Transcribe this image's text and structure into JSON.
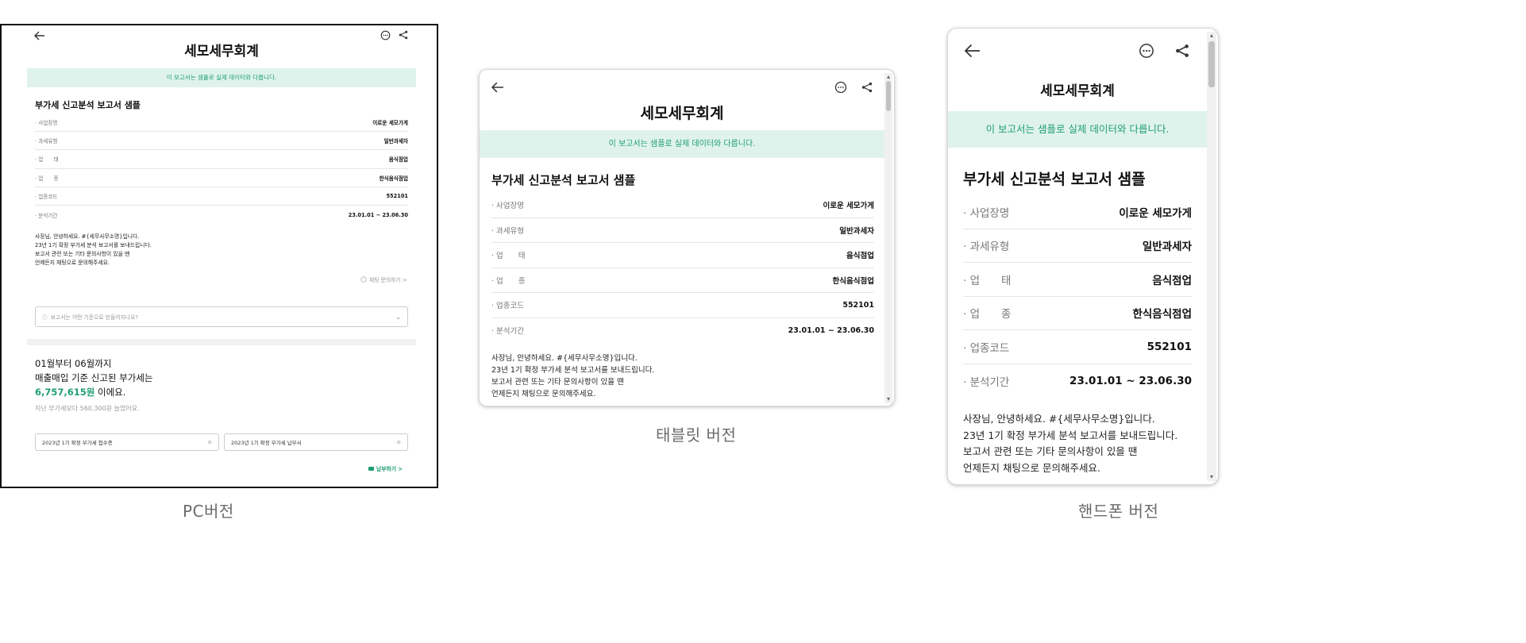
{
  "common": {
    "brand": "세모세무회계",
    "banner": "이 보고서는 샘플로 실제 데이터와 다릅니다.",
    "report_title": "부가세 신고분석 보고서 샘플",
    "rows": [
      {
        "label": "· 사업장명",
        "value": "이로운 세모가게"
      },
      {
        "label": "· 과세유형",
        "value": "일반과세자"
      },
      {
        "label": "· 업　　태",
        "value": "음식점업"
      },
      {
        "label": "· 업　　종",
        "value": "한식음식점업"
      },
      {
        "label": "· 업종코드",
        "value": "552101"
      },
      {
        "label": "· 분석기간",
        "value": "23.01.01 ~ 23.06.30"
      }
    ],
    "message_lines": [
      "사장님, 안녕하세요. #{세무사무소명}입니다.",
      "23년 1기 확정 부가세 분석 보고서를 보내드립니다.",
      "보고서 관련 또는 기타 문의사항이 있을 땐",
      "언제든지 채팅으로 문의해주세요."
    ],
    "icons": {
      "back": "back-arrow-icon",
      "chat": "chat-icon",
      "share": "share-icon"
    }
  },
  "pc": {
    "caption": "PC버전",
    "chat_link": "채팅 문의하기 >",
    "faq_placeholder": "보고서는 어떤 기준으로 만들어지나요?",
    "summary_line1": "01월부터 06월까지",
    "summary_line2": "매출매입 기준 신고된 부가세는",
    "summary_amount": "6,757,615원",
    "summary_suffix": " 이에요.",
    "summary_sub": "지난 부가세보다 560,300원 늘었어요.",
    "file1": "2023년 1기 확정 부가세 접수증",
    "file2": "2023년 1기 확정 부가세 납부서",
    "pay_link": "납부하기 >"
  },
  "tablet": {
    "caption": "태블릿 버전"
  },
  "phone": {
    "caption": "핸드폰 버전"
  },
  "colors": {
    "accent": "#1f9e73",
    "banner_bg": "#dff3ec"
  }
}
